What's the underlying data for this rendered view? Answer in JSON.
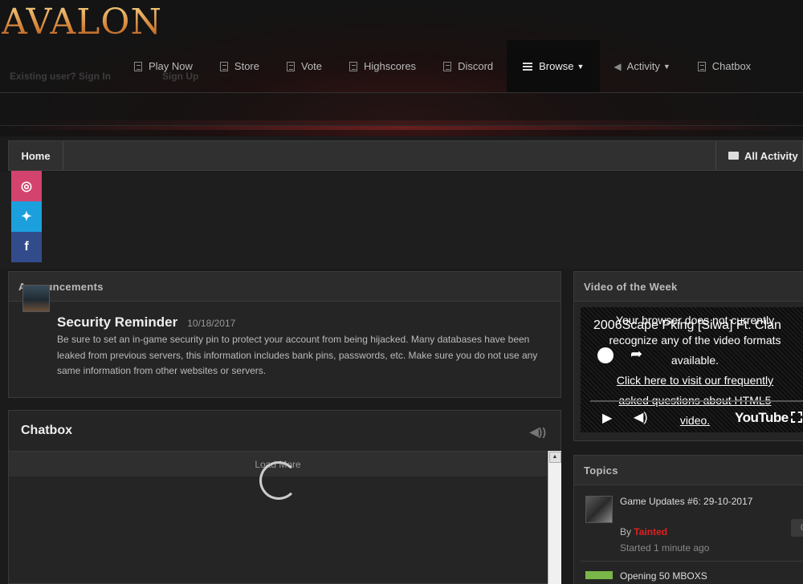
{
  "logo": "AVALON",
  "auth": {
    "signin": "Existing user? Sign In",
    "signup": "Sign Up"
  },
  "nav": [
    {
      "label": "Play Now",
      "icon": "document-icon"
    },
    {
      "label": "Store",
      "icon": "document-icon"
    },
    {
      "label": "Vote",
      "icon": "document-icon"
    },
    {
      "label": "Highscores",
      "icon": "document-icon"
    },
    {
      "label": "Discord",
      "icon": "document-icon"
    },
    {
      "label": "Browse",
      "icon": "list-icon"
    },
    {
      "label": "Activity",
      "icon": "megaphone-icon"
    },
    {
      "label": "Chatbox",
      "icon": "document-icon"
    }
  ],
  "breadcrumb": {
    "home": "Home",
    "all_activity": "All Activity"
  },
  "announcements": {
    "heading": "Announcements",
    "title": "Security Reminder",
    "date": "10/18/2017",
    "body": "Be sure to set an in-game security pin to protect your account from being hijacked. Many databases have been leaked from previous servers, this information includes bank pins, passwords, etc. Make sure you do not use any same information from other websites or servers."
  },
  "chatbox": {
    "heading": "Chatbox",
    "load_more": "Load More"
  },
  "video": {
    "heading": "Video of the Week",
    "title": "2006Scape Pking [Siwa] Ft. Clan",
    "msg1": "Your browser does not currently recognize any of the video formats available.",
    "msg2": "Click here to visit our frequently asked questions about HTML5 video.",
    "brand": "YouTube"
  },
  "topics": {
    "heading": "Topics",
    "items": [
      {
        "title": "Game Updates #6: 29-10-2017",
        "by": "By",
        "author": "Tainted",
        "started": "Started 1 minute ago",
        "count": "0"
      },
      {
        "title": "Opening 50 MBOXS"
      }
    ]
  },
  "colors": {
    "author": "#e02020",
    "instagram": "#d2436d",
    "twitter": "#1ca0dd",
    "facebook": "#324c8b"
  }
}
